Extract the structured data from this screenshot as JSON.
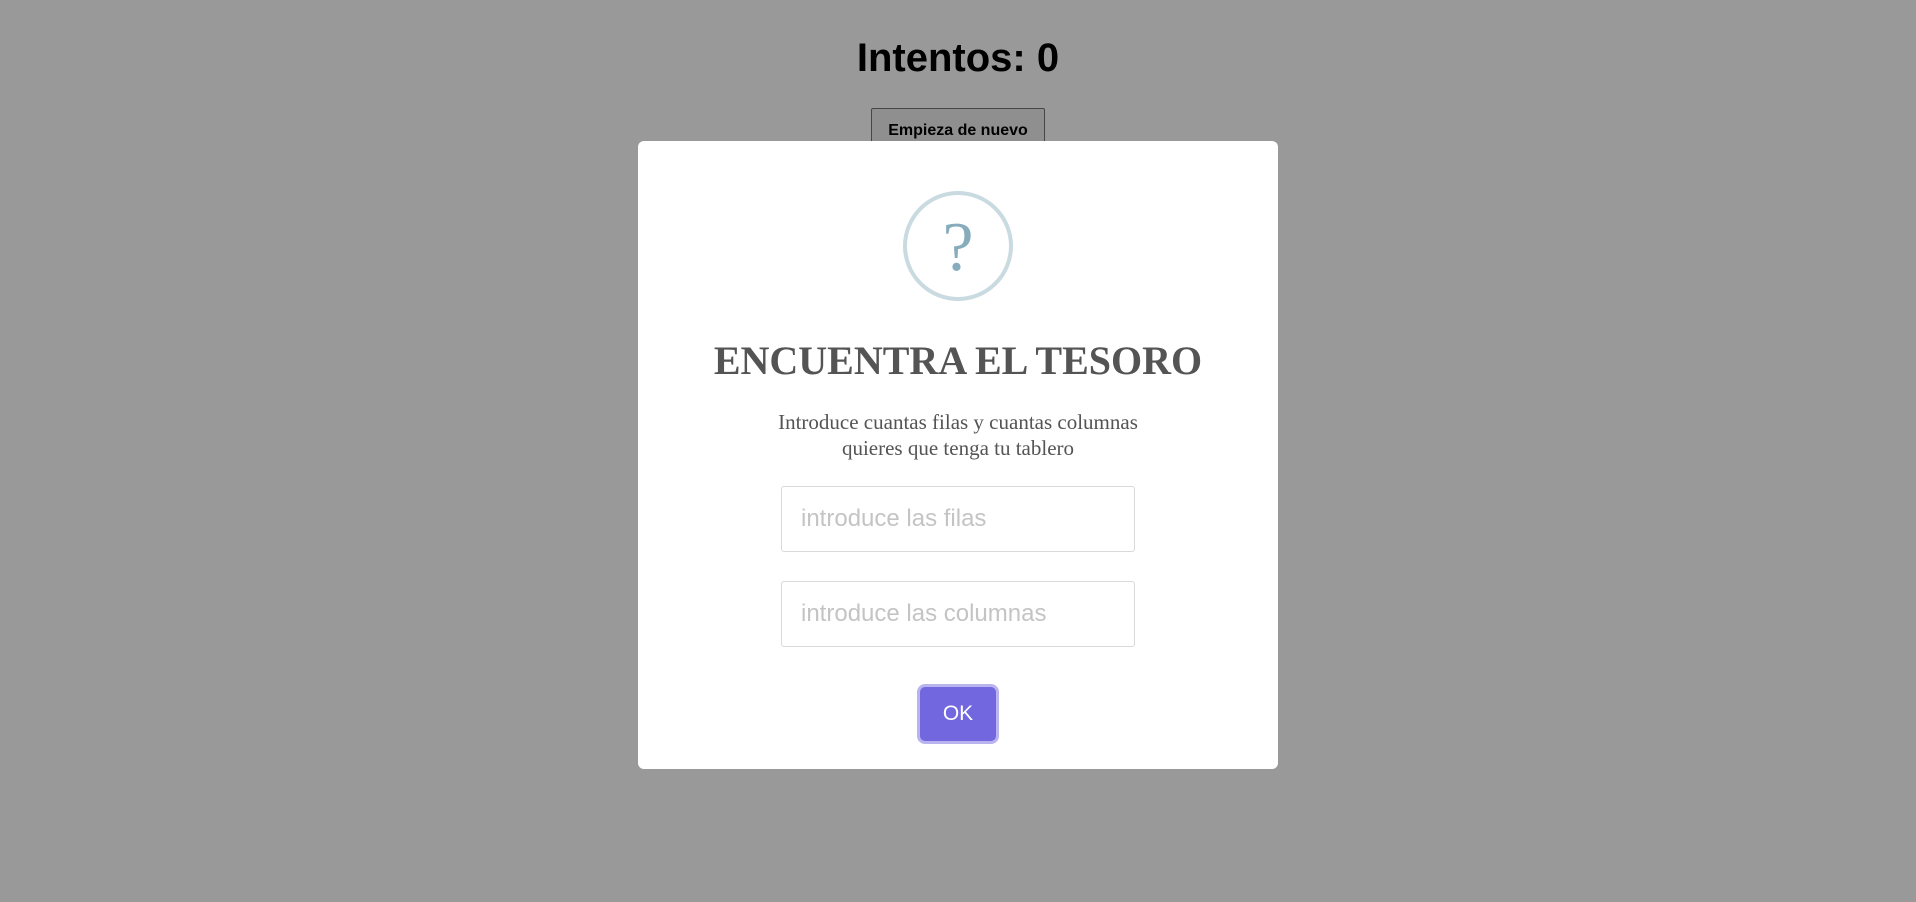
{
  "page": {
    "attempts_title": "Intentos: 0",
    "restart_label": "Empieza de nuevo"
  },
  "dialog": {
    "icon": "question-icon",
    "icon_glyph": "?",
    "title": "ENCUENTRA EL TESORO",
    "text": "Introduce cuantas filas y cuantas columnas quieres que tenga tu tablero",
    "rows_input": {
      "value": "",
      "placeholder": "introduce las filas"
    },
    "columns_input": {
      "value": "",
      "placeholder": "introduce las columnas"
    },
    "ok_label": "OK"
  },
  "colors": {
    "accent": "#7367e0",
    "icon": "#87adbd",
    "icon_border": "#c9dae1",
    "text": "#545454",
    "overlay": "rgba(0,0,0,0.4)"
  }
}
